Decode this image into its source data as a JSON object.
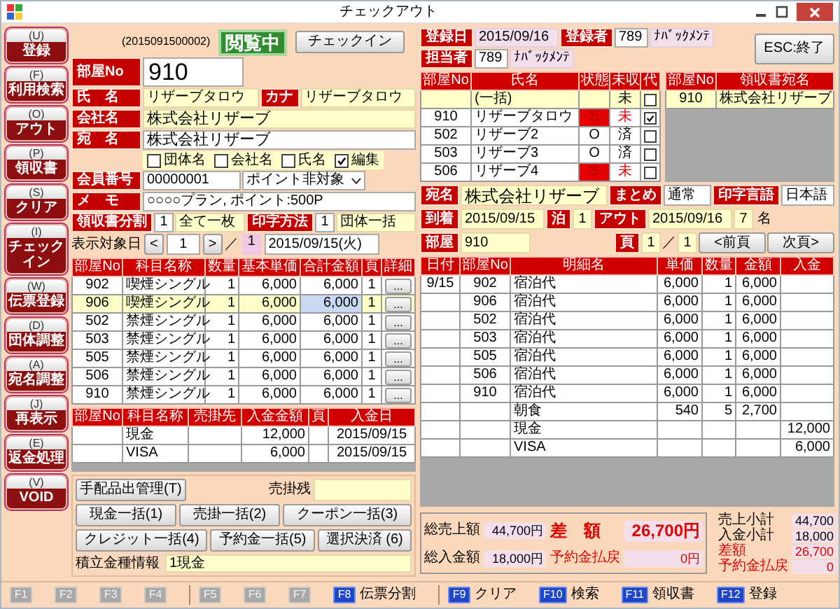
{
  "window": {
    "title": "チェックアウト"
  },
  "sidebar": [
    {
      "key": "(U)",
      "label": "登録"
    },
    {
      "key": "(F)",
      "label": "利用検索"
    },
    {
      "key": "(O)",
      "label": "アウト"
    },
    {
      "key": "(P)",
      "label": "領収書"
    },
    {
      "key": "(S)",
      "label": "クリア"
    },
    {
      "key": "(I)",
      "label": "チェックイン"
    },
    {
      "key": "(W)",
      "label": "伝票登録"
    },
    {
      "key": "(D)",
      "label": "団体調整"
    },
    {
      "key": "(A)",
      "label": "宛名調整"
    },
    {
      "key": "(J)",
      "label": "再表示"
    },
    {
      "key": "(E)",
      "label": "返金処理"
    },
    {
      "key": "(V)",
      "label": "VOID"
    }
  ],
  "header": {
    "reservation_no": "(2015091500002)",
    "mode_badge": "閲覧中",
    "checkin_button": "チェックイン"
  },
  "guest": {
    "room_label": "部屋No",
    "room": "910",
    "name_label": "氏　名",
    "name": "リザーブタロウ",
    "kana_label": "カナ",
    "kana": "リザーブタロウ",
    "company_label": "会社名",
    "company": "株式会社リザーブ",
    "addressee_label": "宛　名",
    "addressee": "株式会社リザーブ",
    "flags": [
      {
        "label": "団体名",
        "checked": false
      },
      {
        "label": "会社名",
        "checked": false
      },
      {
        "label": "氏名",
        "checked": false
      },
      {
        "label": "編集",
        "checked": true
      }
    ],
    "member_label": "会員番号",
    "member_no": "00000001",
    "point_select": "ポイント非対象",
    "memo_label": "メ　モ",
    "memo": "○○○○プラン, ポイント:500P",
    "split_label": "領収書分割",
    "split_no": "1",
    "split_value": "全て一枚",
    "print_label": "印字方法",
    "print_no": "1",
    "print_value": "団体一括",
    "date_label": "表示対象日",
    "prev": "<",
    "page": "1",
    "next": ">",
    "slash": "／",
    "page_total": "1",
    "date": "2015/09/15(火)"
  },
  "charges": {
    "columns": [
      "部屋No",
      "科目名称",
      "数量",
      "基本単価",
      "合計金額",
      "頁",
      "詳細"
    ],
    "rows": [
      {
        "cells": [
          "902",
          "喫煙シングル",
          "1",
          "6,000",
          "6,000",
          "1"
        ],
        "detail": "...",
        "selected": false
      },
      {
        "cells": [
          "906",
          "喫煙シングル",
          "1",
          "6,000",
          "6,000",
          "1"
        ],
        "detail": "...",
        "selected": true
      },
      {
        "cells": [
          "502",
          "禁煙シングル",
          "1",
          "6,000",
          "6,000",
          "1"
        ],
        "detail": "...",
        "selected": false
      },
      {
        "cells": [
          "503",
          "禁煙シングル",
          "1",
          "6,000",
          "6,000",
          "1"
        ],
        "detail": "...",
        "selected": false
      },
      {
        "cells": [
          "505",
          "禁煙シングル",
          "1",
          "6,000",
          "6,000",
          "1"
        ],
        "detail": "...",
        "selected": false
      },
      {
        "cells": [
          "506",
          "禁煙シングル",
          "1",
          "6,000",
          "6,000",
          "1"
        ],
        "detail": "...",
        "selected": false
      },
      {
        "cells": [
          "910",
          "禁煙シングル",
          "1",
          "6,000",
          "6,000",
          "1"
        ],
        "detail": "...",
        "selected": false
      }
    ]
  },
  "payments": {
    "columns": [
      "部屋No",
      "科目名称",
      "売掛先",
      "入金金額",
      "頁",
      "入金日"
    ],
    "rows": [
      {
        "cells": [
          null,
          "現金",
          null,
          "12,000",
          null,
          "2015/09/15"
        ]
      },
      {
        "cells": [
          null,
          "VISA",
          null,
          "6,000",
          null,
          "2015/09/15"
        ]
      }
    ]
  },
  "actions": {
    "arrange_button": "手配品出管理(T)",
    "receivable_label": "売掛残",
    "buttons": [
      "現金一括(1)",
      "売掛一括(2)",
      "クーポン一括(3)",
      "クレジット一括(4)",
      "予約金一括(5)",
      "選択決済 (6)"
    ],
    "deposit_label": "積立金種情報",
    "deposit_value": "1現金"
  },
  "registration": {
    "date_label": "登録日",
    "date": "2015/09/16",
    "registrar_label": "登録者",
    "registrar_code": "789",
    "registrar_name": "ﾅﾊﾞｯｸﾒﾝﾃ",
    "staff_label": "担当者",
    "staff_code": "789",
    "staff_name": "ﾅﾊﾞｯｸﾒﾝﾃ",
    "exit_button": "ESC:終了"
  },
  "guests": {
    "columns": [
      "部屋No",
      "氏名",
      "状態",
      "未収",
      "代"
    ],
    "rows": [
      {
        "cells": [
          null,
          "(一括)",
          null,
          "未"
        ],
        "alert": false,
        "substitute": false,
        "selected": true
      },
      {
        "cells": [
          "910",
          "リザーブタロウ",
          "S",
          "未"
        ],
        "alert": true,
        "substitute": true,
        "selected": false
      },
      {
        "cells": [
          "502",
          "リザーブ2",
          "O",
          "済"
        ],
        "alert": false,
        "substitute": false,
        "selected": false
      },
      {
        "cells": [
          "503",
          "リザーブ3",
          "O",
          "済"
        ],
        "alert": false,
        "substitute": false,
        "selected": false
      },
      {
        "cells": [
          "506",
          "リザーブ4",
          "S",
          "未"
        ],
        "alert": true,
        "substitute": false,
        "selected": false
      }
    ]
  },
  "receipts": {
    "columns": [
      "部屋No",
      "領収書宛名"
    ],
    "rows": [
      {
        "cells": [
          "910",
          "株式会社リザーブ"
        ],
        "selected": true
      }
    ]
  },
  "stay": {
    "addressee_label": "宛名",
    "addressee": "株式会社リザーブ",
    "summary_label": "まとめ",
    "summary": "通常",
    "language_label": "印字言語",
    "language": "日本語",
    "arrival_label": "到着",
    "arrival": "2015/09/15",
    "nights_label": "泊",
    "nights": "1",
    "out_label": "アウト",
    "out": "2015/09/16",
    "guest_count": "7",
    "guest_unit": "名",
    "room_label": "部屋",
    "room": "910",
    "page_label": "頁",
    "page": "1",
    "page_slash": "／",
    "page_total": "1",
    "prev_button": "<前頁",
    "next_button": "次頁>"
  },
  "details": {
    "columns": [
      "日付",
      "部屋No",
      "明細名",
      "単価",
      "数量",
      "金額",
      "入金"
    ],
    "rows": [
      {
        "cells": [
          "9/15",
          "902",
          "宿泊代",
          "6,000",
          "1",
          "6,000",
          null
        ]
      },
      {
        "cells": [
          null,
          "906",
          "宿泊代",
          "6,000",
          "1",
          "6,000",
          null
        ]
      },
      {
        "cells": [
          null,
          "502",
          "宿泊代",
          "6,000",
          "1",
          "6,000",
          null
        ]
      },
      {
        "cells": [
          null,
          "503",
          "宿泊代",
          "6,000",
          "1",
          "6,000",
          null
        ]
      },
      {
        "cells": [
          null,
          "505",
          "宿泊代",
          "6,000",
          "1",
          "6,000",
          null
        ]
      },
      {
        "cells": [
          null,
          "506",
          "宿泊代",
          "6,000",
          "1",
          "6,000",
          null
        ]
      },
      {
        "cells": [
          null,
          "910",
          "宿泊代",
          "6,000",
          "1",
          "6,000",
          null
        ]
      },
      {
        "cells": [
          null,
          null,
          "朝食",
          "540",
          "5",
          "2,700",
          null
        ]
      },
      {
        "cells": [
          null,
          null,
          "現金",
          null,
          null,
          null,
          "12,000"
        ]
      },
      {
        "cells": [
          null,
          null,
          "VISA",
          null,
          null,
          null,
          "6,000"
        ]
      }
    ]
  },
  "totals": {
    "sales_label": "総売上額",
    "sales": "44,700円",
    "paid_label": "総入金額",
    "paid": "18,000円",
    "diff_label": "差　額",
    "diff": "26,700円",
    "refund_label": "予約金払戻",
    "refund": "0円",
    "sub": [
      {
        "label": "売上小計",
        "value": "44,700",
        "kind": "normal"
      },
      {
        "label": "入金小計",
        "value": "18,000",
        "kind": "normal"
      },
      {
        "label": "差額",
        "value": "26,700",
        "kind": "alert"
      },
      {
        "label": "予約金払戻",
        "value": "0",
        "kind": "alert"
      }
    ]
  },
  "function_keys": [
    {
      "key": "F1",
      "enabled": false
    },
    {
      "key": "F2",
      "enabled": false
    },
    {
      "key": "F3",
      "enabled": false
    },
    {
      "key": "F4",
      "enabled": false
    },
    {
      "key": "F5",
      "enabled": false
    },
    {
      "key": "F6",
      "enabled": false
    },
    {
      "key": "F7",
      "enabled": false
    },
    {
      "key": "F8",
      "label": "伝票分割",
      "enabled": true
    },
    {
      "key": "F9",
      "label": "クリア",
      "enabled": true
    },
    {
      "key": "F10",
      "label": "検索",
      "enabled": true
    },
    {
      "key": "F11",
      "label": "領収書",
      "enabled": true
    },
    {
      "key": "F12",
      "label": "登録",
      "enabled": true
    }
  ]
}
